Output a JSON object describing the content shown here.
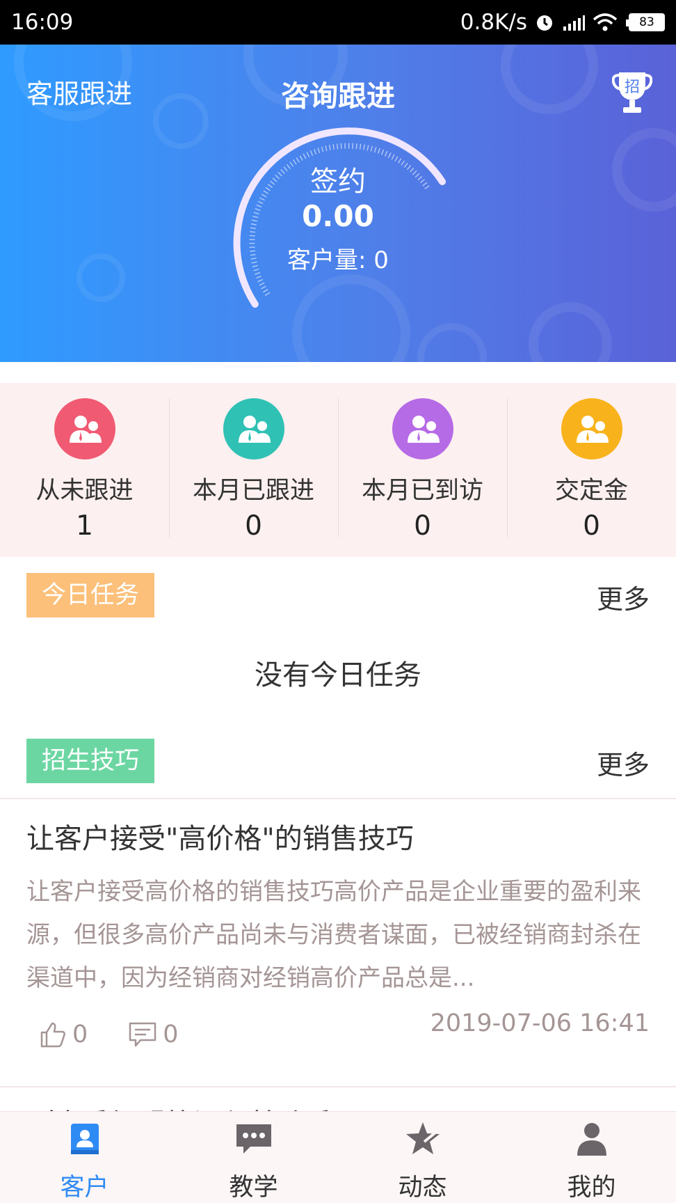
{
  "status_bar": {
    "time": "16:09",
    "net_speed": "0.8K/s",
    "battery": "83"
  },
  "header": {
    "left_tab": "客服跟进",
    "title": "咨询跟进",
    "trophy_badge": "招",
    "gauge_title": "签约",
    "gauge_value": "0.00",
    "gauge_sub": "客户量: 0"
  },
  "stats": [
    {
      "label": "从未跟进",
      "value": "1",
      "color": "#f05a73",
      "icon": "users-icon"
    },
    {
      "label": "本月已跟进",
      "value": "0",
      "color": "#2fc1b4",
      "icon": "users-icon"
    },
    {
      "label": "本月已到访",
      "value": "0",
      "color": "#b66be6",
      "icon": "users-icon"
    },
    {
      "label": "交定金",
      "value": "0",
      "color": "#f8b21b",
      "icon": "users-icon"
    }
  ],
  "today_tasks": {
    "tag": "今日任务",
    "more": "更多",
    "empty": "没有今日任务",
    "tag_color": "#fcc07a"
  },
  "tips": {
    "tag": "招生技巧",
    "more": "更多",
    "tag_color": "#6cd6a2",
    "article": {
      "title": "让客户接受\"高价格\"的销售技巧",
      "body": "让客户接受高价格的销售技巧高价产品是企业重要的盈利来源，但很多高价产品尚未与消费者谋面，已被经销商封杀在渠道中，因为经销商对经销高价产品总是...",
      "likes": "0",
      "comments": "0",
      "date": "2019-07-06 16:41"
    },
    "next_peek": "（春季加盟校课程基础手册"
  },
  "bottom_nav": [
    {
      "label": "客户",
      "icon": "customer-icon",
      "active": true
    },
    {
      "label": "教学",
      "icon": "chat-icon",
      "active": false
    },
    {
      "label": "动态",
      "icon": "star-icon",
      "active": false
    },
    {
      "label": "我的",
      "icon": "person-icon",
      "active": false
    }
  ],
  "colors": {
    "accent": "#2f8bf4",
    "header_start": "#2f9bff",
    "header_end": "#5a62d8"
  }
}
